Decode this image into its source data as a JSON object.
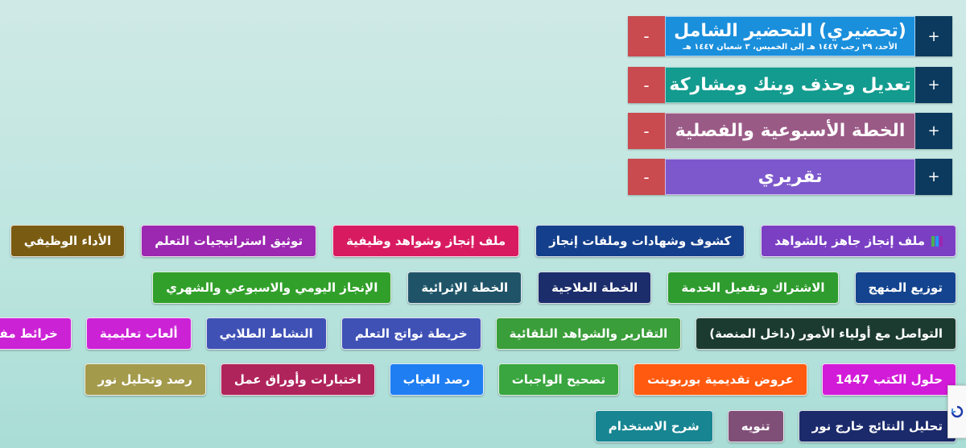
{
  "accordion": [
    {
      "title": "(تحضيري) التحضير الشامل",
      "subtitle": "الأحد، ٢٩ رجب ١٤٤٧ هـ إلى الخميس، ٣ شعبان ١٤٤٧ هـ",
      "color": "#1a8fdc",
      "plus": "+",
      "minus": "-"
    },
    {
      "title": "تعديل وحذف وبنك ومشاركة",
      "subtitle": "",
      "color": "#129b8e",
      "plus": "+",
      "minus": "-"
    },
    {
      "title": "الخطة الأسبوعية والفصلية",
      "subtitle": "",
      "color": "#9a5a86",
      "plus": "+",
      "minus": "-"
    },
    {
      "title": "تقريري",
      "subtitle": "",
      "color": "#7d58cc",
      "plus": "+",
      "minus": "-"
    }
  ],
  "button_rows": [
    [
      {
        "label": "ملف إنجاز جاهز بالشواهد",
        "color": "#7b3fc4",
        "icon": "books-icon"
      },
      {
        "label": "كشوف وشهادات وملفات إنجاز",
        "color": "#143f8c"
      },
      {
        "label": "ملف إنجاز وشواهد وظيفية",
        "color": "#d81b60"
      },
      {
        "label": "توثيق استراتيجيات التعلم",
        "color": "#9c27b0"
      },
      {
        "label": "الأداء الوظيفي",
        "color": "#7a5b12"
      }
    ],
    [
      {
        "label": "توزيع المنهج",
        "color": "#14448f"
      },
      {
        "label": "الاشتراك وتفعيل الخدمة",
        "color": "#2e9c2e"
      },
      {
        "label": "الخطة العلاجية",
        "color": "#1c2d6b"
      },
      {
        "label": "الخطة الإثرائية",
        "color": "#1f5468"
      },
      {
        "label": "الإنجاز اليومي والاسبوعي والشهري",
        "color": "#31a02a"
      }
    ],
    [
      {
        "label": "التواصل مع أولياء الأمور (داخل المنصة)",
        "color": "#1b3b30"
      },
      {
        "label": "التقارير والشواهد التلقائية",
        "color": "#3a9e3a"
      },
      {
        "label": "خريطة نواتج التعلم",
        "color": "#3f51b5"
      },
      {
        "label": "النشاط الطلابي",
        "color": "#3f51b5"
      },
      {
        "label": "ألعاب تعليمية",
        "color": "#cc22d6"
      },
      {
        "label": "خرائط مفاهيم",
        "color": "#cc22d6"
      }
    ],
    [
      {
        "label": "حلول الكتب 1447",
        "color": "#d21bd8"
      },
      {
        "label": "عروض تقديمية بوربوينت",
        "color": "#ff5a0f"
      },
      {
        "label": "تصحيح  الواجبات",
        "color": "#3aa640"
      },
      {
        "label": "رصد الغياب",
        "color": "#1e7ef2"
      },
      {
        "label": "اختبارات وأوراق عمل",
        "color": "#b0245c"
      },
      {
        "label": "رصد وتحليل نور",
        "color": "#a39a4c"
      }
    ],
    [
      {
        "label": "تحليل النتائج خارج نور",
        "color": "#1b2a6b"
      },
      {
        "label": "تنويه",
        "color": "#804f78"
      },
      {
        "label": "شرح الاستخدام",
        "color": "#178592"
      }
    ]
  ],
  "books_icon_colors": [
    "#4caf50",
    "#2196f3",
    "#9c27b0"
  ]
}
